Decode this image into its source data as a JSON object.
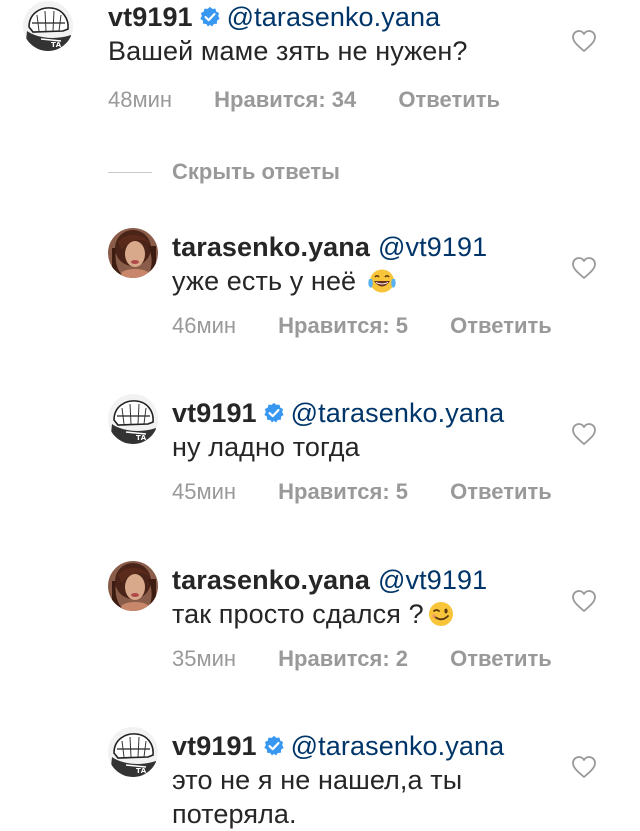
{
  "comments": [
    {
      "username": "vt9191",
      "verified": true,
      "mention": "@tarasenko.yana",
      "text": "Вашей маме зять не нужен?",
      "time": "48мин",
      "likes": "Нравится: 34",
      "reply": "Ответить",
      "avatar": "hockey-avatar"
    },
    {
      "username": "tarasenko.yana",
      "verified": false,
      "mention": "@vt9191",
      "text": "уже есть у неё",
      "emoji": "tears-of-joy",
      "time": "46мин",
      "likes": "Нравится: 5",
      "reply": "Ответить",
      "avatar": "woman-avatar"
    },
    {
      "username": "vt9191",
      "verified": true,
      "mention": "@tarasenko.yana",
      "text": "ну ладно тогда",
      "time": "45мин",
      "likes": "Нравится: 5",
      "reply": "Ответить",
      "avatar": "hockey-avatar"
    },
    {
      "username": "tarasenko.yana",
      "verified": false,
      "mention": "@vt9191",
      "text": "так просто сдался ?",
      "emoji": "winking-face",
      "time": "35мин",
      "likes": "Нравится: 2",
      "reply": "Ответить",
      "avatar": "woman-avatar"
    },
    {
      "username": "vt9191",
      "verified": true,
      "mention": "@tarasenko.yana",
      "text_line1": "это не я не нашел,а ты",
      "text_line2": "потеряла.",
      "avatar": "hockey-avatar"
    }
  ],
  "hide_replies": "Скрыть ответы",
  "colors": {
    "username": "#262626",
    "mention": "#003569",
    "meta": "#999999",
    "verified": "#3897f0",
    "divider": "#c7c7c7"
  }
}
